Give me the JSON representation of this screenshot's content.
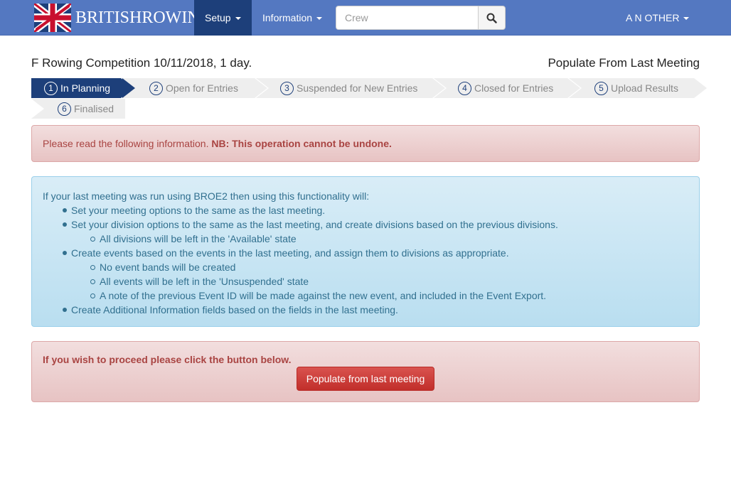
{
  "brand": {
    "text": "BRITISHROWING"
  },
  "nav": {
    "setup_label": "Setup",
    "information_label": "Information",
    "search_placeholder": "Crew",
    "search_value": "",
    "user_label": "A N OTHER"
  },
  "header": {
    "title": "F Rowing Competition 10/11/2018, 1 day.",
    "action_title": "Populate From Last Meeting"
  },
  "steps": [
    {
      "num": "1",
      "label": "In Planning",
      "active": true
    },
    {
      "num": "2",
      "label": "Open for Entries",
      "active": false
    },
    {
      "num": "3",
      "label": "Suspended for New Entries",
      "active": false
    },
    {
      "num": "4",
      "label": "Closed for Entries",
      "active": false
    },
    {
      "num": "5",
      "label": "Upload Results",
      "active": false
    },
    {
      "num": "6",
      "label": "Finalised",
      "active": false
    }
  ],
  "warning": {
    "text": "Please read the following information. ",
    "bold": "NB: This operation cannot be undone."
  },
  "info": {
    "intro": "If your last meeting was run using BROE2 then using this functionality will:",
    "items": [
      {
        "level": 1,
        "text": "Set your meeting options to the same as the last meeting."
      },
      {
        "level": 1,
        "text": "Set your division options to the same as the last meeting, and create divisions based on the previous divisions."
      },
      {
        "level": 2,
        "text": "All divisions will be left in the 'Available' state"
      },
      {
        "level": 1,
        "text": "Create events based on the events in the last meeting, and assign them to divisions as appropriate."
      },
      {
        "level": 2,
        "text": "No event bands will be created"
      },
      {
        "level": 2,
        "text": "All events will be left in the 'Unsuspended' state"
      },
      {
        "level": 2,
        "text": "A note of the previous Event ID will be made against the new event, and included in the Event Export."
      },
      {
        "level": 1,
        "text": "Create Additional Information fields based on the fields in the last meeting."
      }
    ]
  },
  "proceed": {
    "text": "If you wish to proceed please click the button below.",
    "button_label": "Populate from last meeting"
  },
  "colors": {
    "navbar": "#5478c1",
    "active": "#1d3f7a",
    "danger_text": "#a94442",
    "info_text": "#31708f",
    "button": "#d9534f"
  }
}
